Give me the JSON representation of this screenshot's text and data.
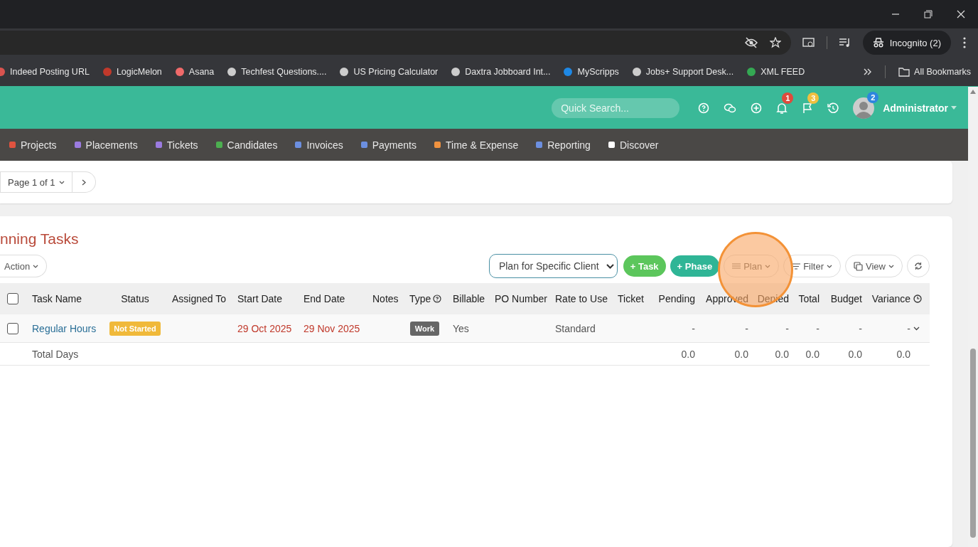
{
  "browser": {
    "incognito": "Incognito (2)",
    "all_bookmarks": "All Bookmarks",
    "bookmarks": [
      {
        "label": "Indeed Posting URL",
        "color": "#d9534f"
      },
      {
        "label": "LogicMelon",
        "color": "#c0392b"
      },
      {
        "label": "Asana",
        "color": "#f06a6a"
      },
      {
        "label": "Techfest Questions....",
        "color": "#cccccc"
      },
      {
        "label": "US Pricing Calculator",
        "color": "#cccccc"
      },
      {
        "label": "Daxtra Jobboard Int...",
        "color": "#cccccc"
      },
      {
        "label": "MyScripps",
        "color": "#1e88e5"
      },
      {
        "label": "Jobs+ Support Desk...",
        "color": "#cccccc"
      },
      {
        "label": "XML FEED",
        "color": "#34a853"
      }
    ]
  },
  "header": {
    "search_placeholder": "Quick Search...",
    "notifications_count": "1",
    "flags_count": "3",
    "avatar_count": "2",
    "user": "Administrator"
  },
  "nav": [
    {
      "label": "Projects",
      "color": "#e0533f"
    },
    {
      "label": "Placements",
      "color": "#9b7be0"
    },
    {
      "label": "Tickets",
      "color": "#9b7be0"
    },
    {
      "label": "Candidates",
      "color": "#4caf50"
    },
    {
      "label": "Invoices",
      "color": "#6c8fe0"
    },
    {
      "label": "Payments",
      "color": "#6c8fe0"
    },
    {
      "label": "Time & Expense",
      "color": "#f0923f"
    },
    {
      "label": "Reporting",
      "color": "#6c8fe0"
    },
    {
      "label": "Discover",
      "color": "#ffffff"
    }
  ],
  "pager": {
    "page": "Page 1 of 1"
  },
  "panel": {
    "title": "nning Tasks",
    "action": "Action",
    "client_select": "Plan for Specific Client",
    "task_button": "+ Task",
    "phase_button": "+ Phase",
    "plan_button": "Plan",
    "filter_button": "Filter",
    "view_button": "View"
  },
  "table": {
    "all_checked": false,
    "columns": [
      "Task Name",
      "Status",
      "Assigned To",
      "Start Date",
      "End Date",
      "Notes",
      "Type",
      "Billable",
      "PO Number",
      "Rate to Use",
      "Ticket",
      "Pending",
      "Approved",
      "Denied",
      "Total",
      "Budget",
      "Variance"
    ],
    "rows": [
      {
        "checked": false,
        "name": "Regular Hours",
        "status": "Not Started",
        "start": "29 Oct 2025",
        "end": "29 Nov 2025",
        "type": "Work",
        "billable": "Yes",
        "rate": "Standard",
        "amounts": [
          "-",
          "-",
          "-",
          "-",
          "-",
          "-"
        ]
      }
    ],
    "total": {
      "label": "Total Days",
      "amounts": [
        "0.0",
        "0.0",
        "0.0",
        "0.0",
        "0.0",
        "0.0"
      ]
    }
  }
}
